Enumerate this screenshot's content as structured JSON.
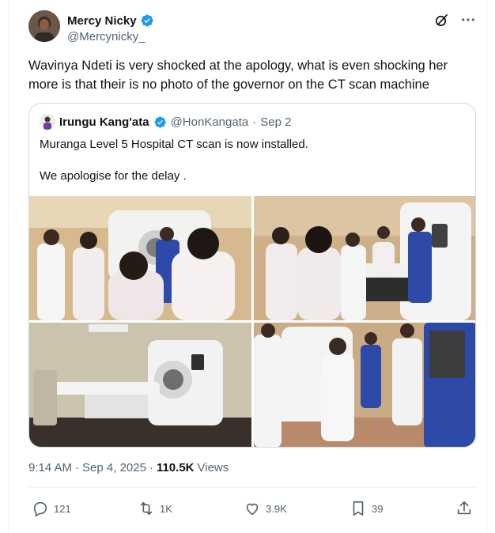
{
  "author": {
    "name": "Mercy Nicky",
    "handle": "@Mercynicky_",
    "verified_color": "#1d9bf0"
  },
  "tweet": {
    "text": "Wavinya Ndeti is very shocked at the apology, what is even shocking her more is that their is no photo of the governor on the CT scan machine"
  },
  "quoted": {
    "name": "Irungu Kang'ata",
    "handle": "@HonKangata",
    "separator": "·",
    "date": "Sep 2",
    "line1": "Muranga Level 5 Hospital CT scan is now installed.",
    "line2": "We apologise for the delay ."
  },
  "meta": {
    "time": "9:14 AM",
    "separator": "·",
    "date": "Sep 4, 2025",
    "separator2": "·",
    "views_count": "110.5K",
    "views_label": "Views"
  },
  "actions": {
    "replies": "121",
    "reposts": "1K",
    "likes": "3.9K",
    "bookmarks": "39"
  },
  "icons": {
    "grok": "grok-icon",
    "more": "more-icon",
    "reply": "reply-icon",
    "repost": "repost-icon",
    "like": "heart-icon",
    "bookmark": "bookmark-icon",
    "share": "share-icon"
  },
  "colors": {
    "text": "#0f1419",
    "secondary": "#536471",
    "border": "#cfd9de",
    "brand": "#1d9bf0"
  }
}
